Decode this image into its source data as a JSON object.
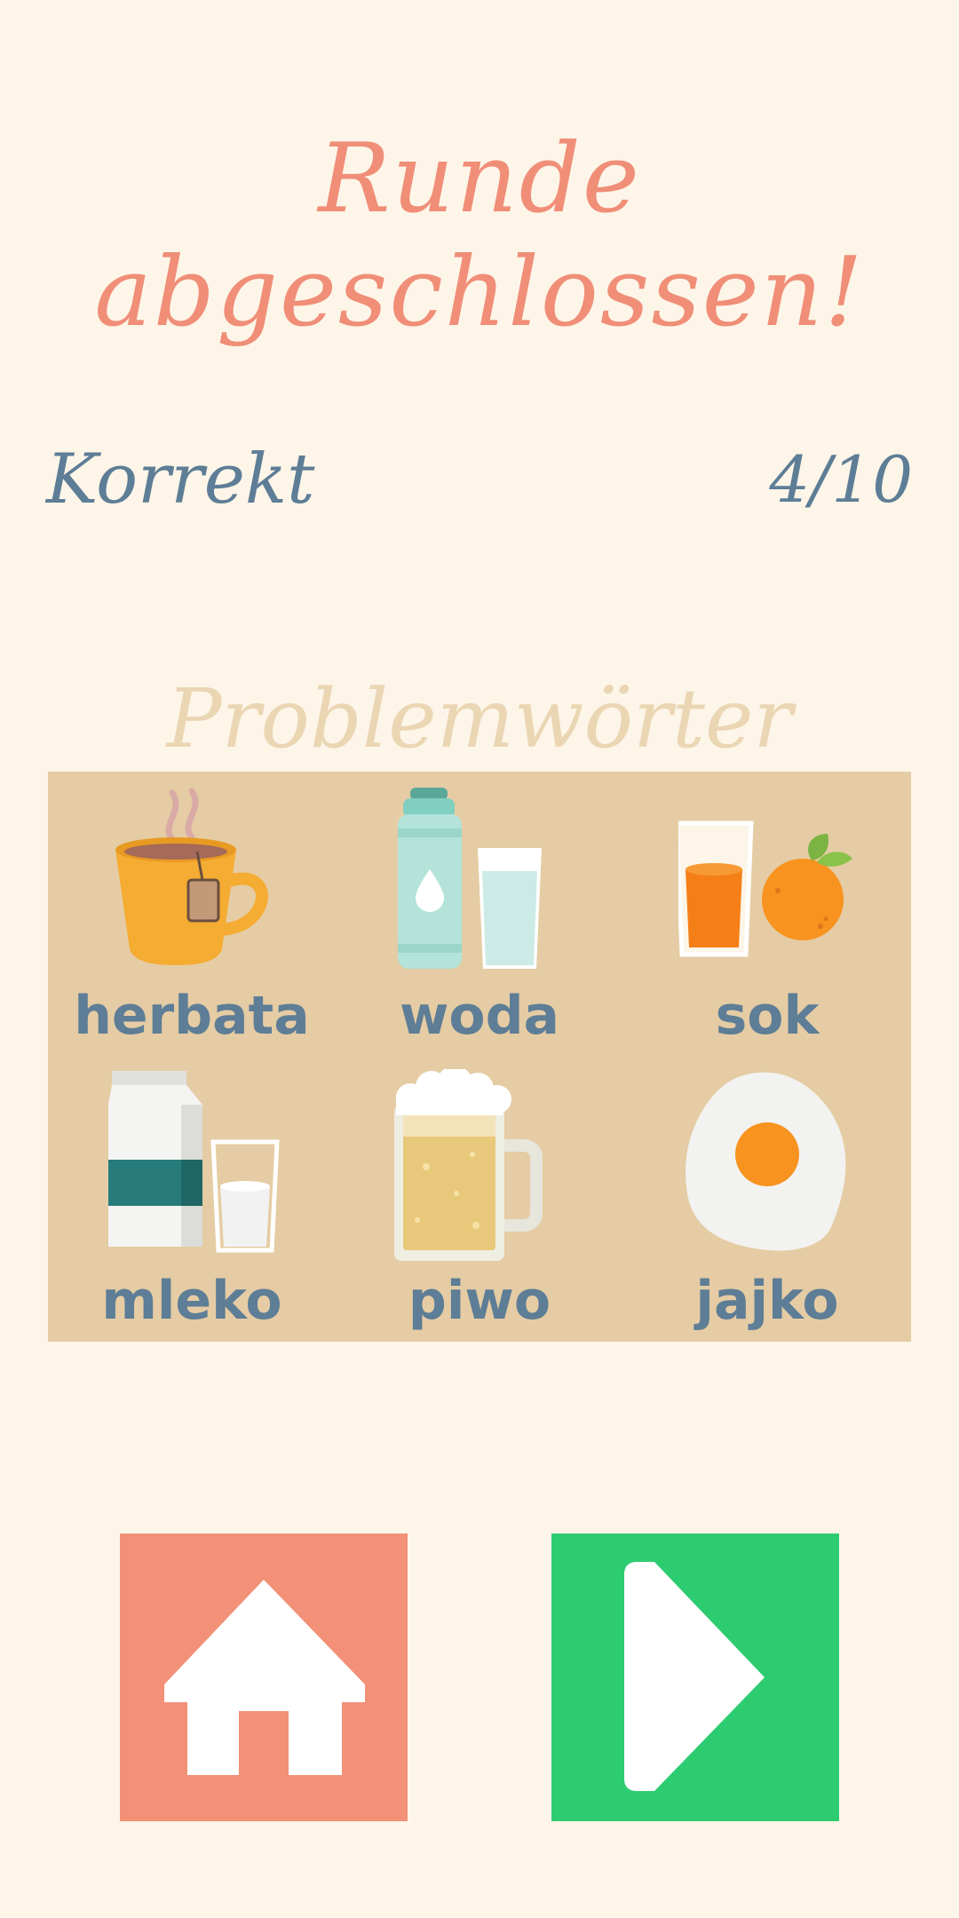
{
  "title": "Runde abgeschlossen!",
  "score": {
    "label": "Korrekt",
    "value": "4/10"
  },
  "problem_words": {
    "heading": "Problemwörter",
    "items": [
      {
        "word": "herbata",
        "icon": "tea-cup-icon"
      },
      {
        "word": "woda",
        "icon": "water-icon"
      },
      {
        "word": "sok",
        "icon": "juice-icon"
      },
      {
        "word": "mleko",
        "icon": "milk-icon"
      },
      {
        "word": "piwo",
        "icon": "beer-icon"
      },
      {
        "word": "jajko",
        "icon": "egg-icon"
      }
    ]
  },
  "buttons": {
    "home_icon": "home-icon",
    "next_icon": "play-icon"
  },
  "colors": {
    "background": "#fdf5e8",
    "title": "#f08e78",
    "text": "#5e7d96",
    "heading": "#ebd6b4",
    "grid": "#e5cca4",
    "home_button": "#f29078",
    "next_button": "#2ecc71"
  }
}
